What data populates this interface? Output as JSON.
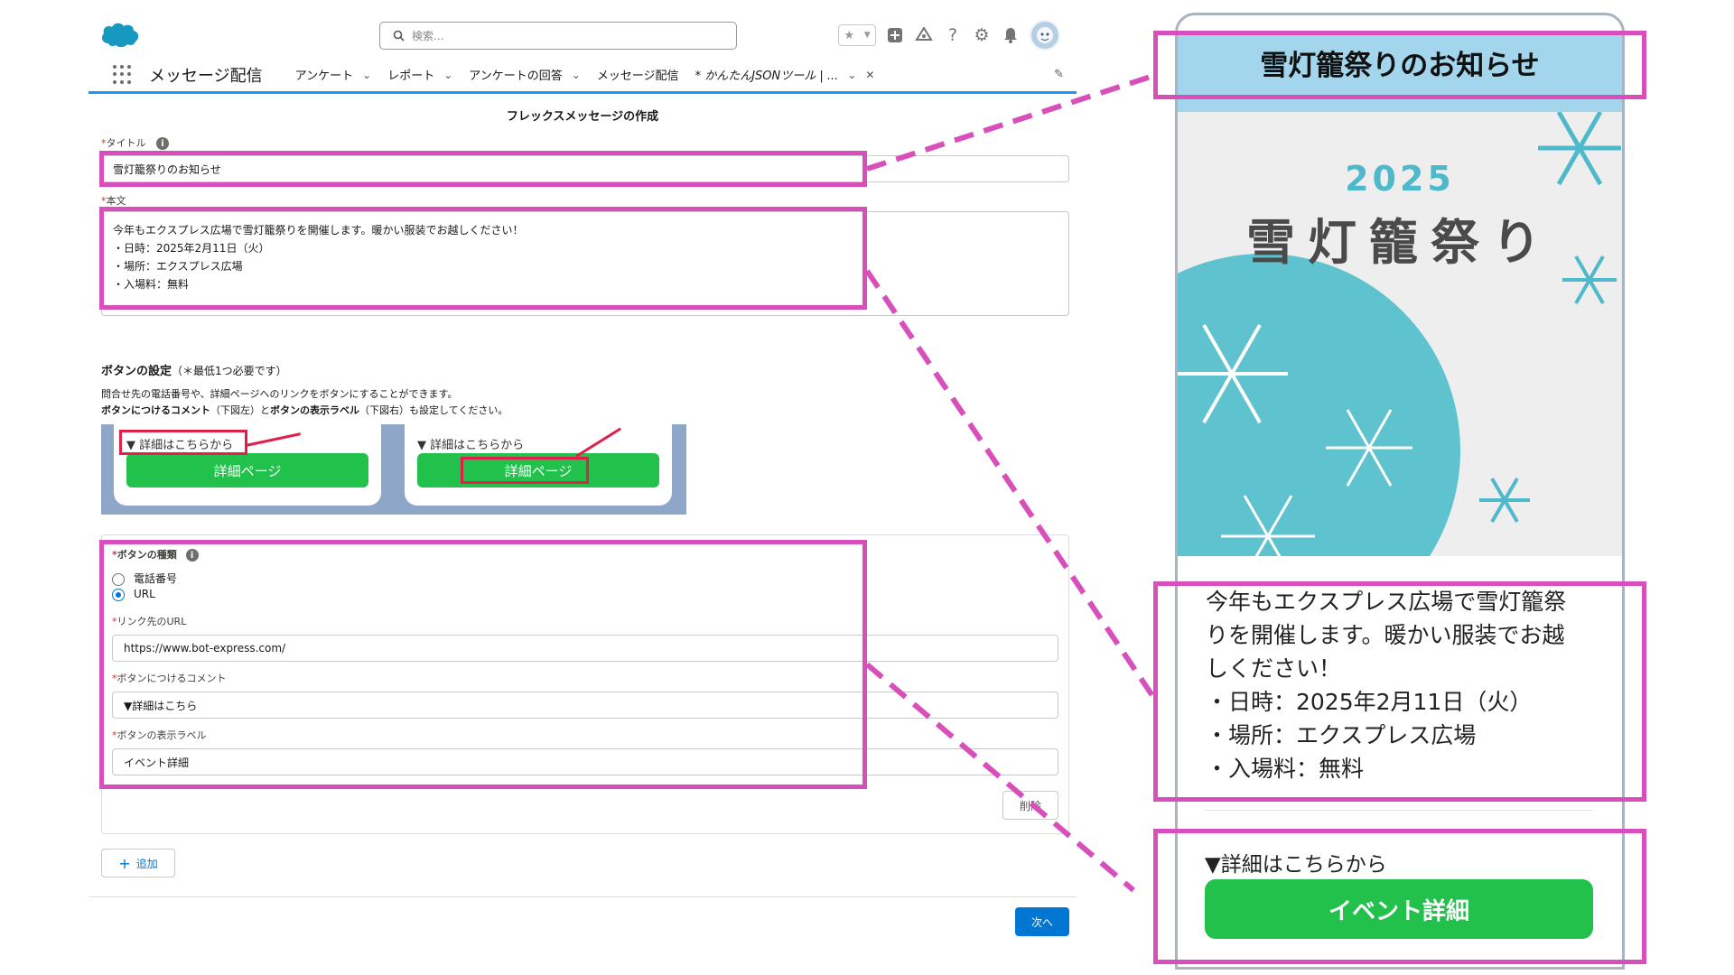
{
  "header": {
    "search_placeholder": "検索...",
    "app_name": "メッセージ配信",
    "tabs": [
      {
        "label": "アンケート"
      },
      {
        "label": "レポート"
      },
      {
        "label": "アンケートの回答"
      },
      {
        "label": "メッセージ配信"
      },
      {
        "label": "* かんたんJSONツール | ..."
      }
    ]
  },
  "form": {
    "heading": "フレックスメッセージの作成",
    "title_label": "タイトル",
    "title_value": "雪灯籠祭りのお知らせ",
    "body_label": "本文",
    "body_lines": [
      "今年もエクスプレス広場で雪灯籠祭りを開催します。暖かい服装でお越しください！",
      "・日時：2025年2月11日（火）",
      "・場所：エクスプレス広場",
      "・入場料：無料"
    ],
    "button_section_title": "ボタンの設定",
    "button_section_note": "（＊最低1つ必要です）",
    "help_line1": "問合せ先の電話番号や、詳細ページへのリンクをボタンにすることができます。",
    "help_line2_bold1": "ボタンにつけるコメント",
    "help_line2_mid1": "（下図左）と",
    "help_line2_bold2": "ボタンの表示ラベル",
    "help_line2_mid2": "（下図右）も設定してください。",
    "preview_left_comment": "▼ 詳細はこちらから",
    "preview_left_button": "詳細ページ",
    "preview_right_comment": "▼ 詳細はこちらから",
    "preview_right_button": "詳細ページ",
    "button_type_label": "ボタンの種類",
    "option_phone": "電話番号",
    "option_url": "URL",
    "url_label": "リンク先のURL",
    "url_value": "https://www.bot-express.com/",
    "comment_label": "ボタンにつけるコメント",
    "comment_value": "▼詳細はこちら",
    "display_label_label": "ボタンの表示ラベル",
    "display_label_value": "イベント詳細",
    "delete_button": "削除",
    "add_button": "追加",
    "next_button": "次へ"
  },
  "phone": {
    "title": "雪灯籠祭りのお知らせ",
    "hero_year": "2025",
    "hero_name": "雪灯籠祭り",
    "body_lines": [
      "今年もエクスプレス広場で雪灯籠祭",
      "りを開催します。暖かい服装でお越",
      "しください！",
      "・日時：2025年2月11日（火）",
      "・場所：エクスプレス広場",
      "・入場料：無料"
    ],
    "button_comment": "▼詳細はこちらから",
    "button_label": "イベント詳細"
  },
  "colors": {
    "highlight": "#d84fbc",
    "line_green": "#21c14b",
    "sf_blue": "#0176d3",
    "title_bar": "#a3d5ec"
  }
}
